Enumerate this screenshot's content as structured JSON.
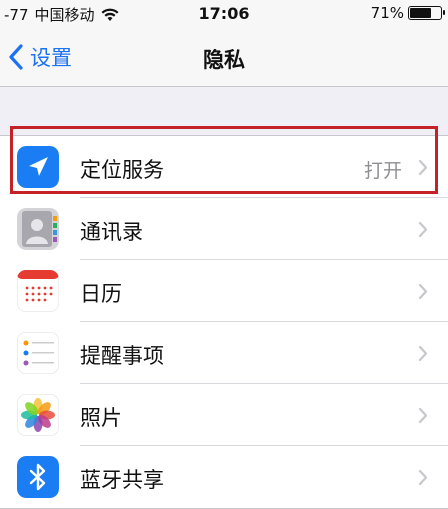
{
  "status_bar": {
    "signal": "-77",
    "carrier": "中国移动",
    "time": "17:06",
    "battery": "71%",
    "battery_level": 0.71
  },
  "nav": {
    "back_label": "设置",
    "title": "隐私"
  },
  "rows": [
    {
      "label": "定位服务",
      "value": "打开",
      "icon": "location-arrow-icon",
      "color": "#1a7df4"
    },
    {
      "label": "通讯录",
      "value": "",
      "icon": "contacts-icon",
      "color": "#9a9aa0"
    },
    {
      "label": "日历",
      "value": "",
      "icon": "calendar-icon",
      "color": "#e53b30"
    },
    {
      "label": "提醒事项",
      "value": "",
      "icon": "reminders-icon",
      "color": "#ff9500"
    },
    {
      "label": "照片",
      "value": "",
      "icon": "photos-icon",
      "color": "#f5a623"
    },
    {
      "label": "蓝牙共享",
      "value": "",
      "icon": "bluetooth-icon",
      "color": "#1a7df4"
    }
  ]
}
